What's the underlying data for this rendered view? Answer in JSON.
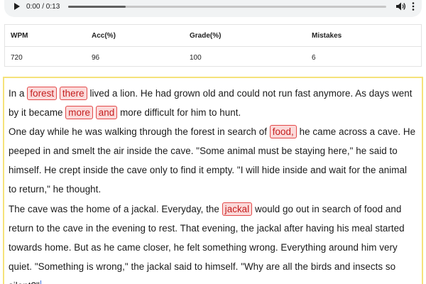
{
  "audio": {
    "time": "0:00 / 0:13",
    "progress": 0.18
  },
  "stats": {
    "headers": [
      "WPM",
      "Acc(%)",
      "Grade(%)",
      "Mistakes"
    ],
    "values": [
      "720",
      "96",
      "100",
      "6"
    ]
  },
  "passage": {
    "p1": {
      "s1": "In a ",
      "e1": "forest",
      "s2": " ",
      "e2": "there",
      "s3": " lived a lion. He had grown old and could not run fast anymore. As days went by it became ",
      "e3": "more",
      "s4": " ",
      "e4": "and",
      "s5": " more difficult for him to hunt."
    },
    "p2": {
      "s1": "One day while he was walking through the forest in search of ",
      "e1": "food,",
      "s2": " he came across a cave. He peeped in and smelt the air inside the cave. \"Some animal must be staying here,\" he said to himself. He crept inside the cave only to find it empty. \"I will hide inside and wait for the animal to return,\" he thought."
    },
    "p3": {
      "s1": "The cave was the home of a jackal. Everyday, the ",
      "e1": "jackal",
      "s2": " would go out in search of food and return to the cave in the evening to rest. That evening, the jackal after having his meal started towards home. But as he came closer, he felt something wrong. Everything around him very quiet. \"Something is wrong,\" the jackal said to himself. \"Why are all the birds and insects so silent?\""
    }
  },
  "icons": {
    "play": "play-icon",
    "volume": "volume-icon",
    "more": "more-vertical-icon"
  },
  "colors": {
    "error_bg": "#fbdada",
    "error_border": "#e34a4a",
    "error_text": "#c41d1d",
    "passage_border": "#f5e27a",
    "caret": "#3b6fe0"
  }
}
